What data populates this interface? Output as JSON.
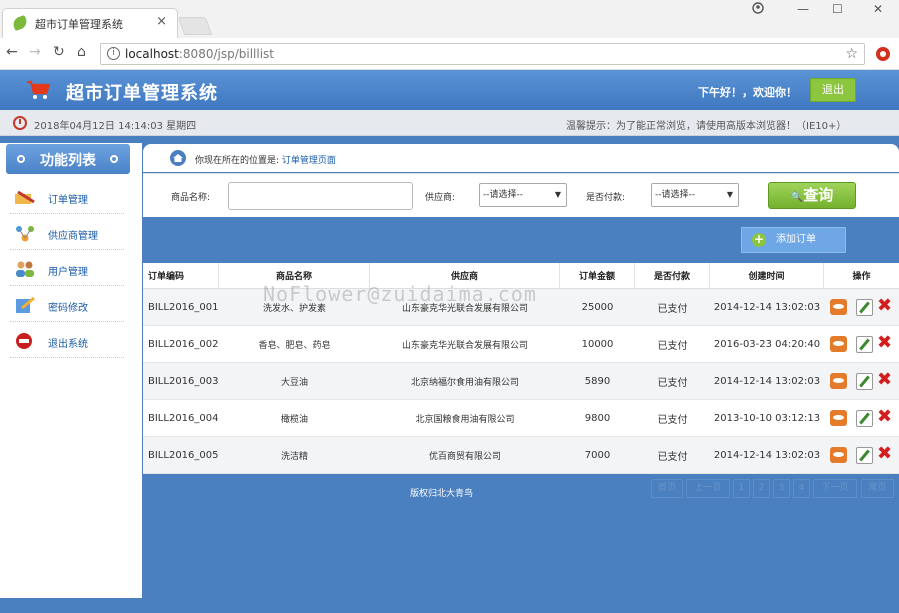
{
  "browser": {
    "tab_title": "超市订单管理系统",
    "tab_close": "×",
    "url_host": "localhost",
    "url_path": ":8080/jsp/billlist",
    "win_minimize": "—",
    "win_maximize": "☐",
    "win_close": "✕"
  },
  "header": {
    "title": "超市订单管理系统",
    "greeting": "下午好！，欢迎你！",
    "logout_label": "退出"
  },
  "info": {
    "datetime": "2018年04月12日 14:14:03 星期四",
    "tip": "温馨提示：为了能正常浏览，请使用高版本浏览器！（IE10+）"
  },
  "sidebar": {
    "title": "功能列表",
    "items": [
      {
        "label": "订单管理"
      },
      {
        "label": "供应商管理"
      },
      {
        "label": "用户管理"
      },
      {
        "label": "密码修改"
      },
      {
        "label": "退出系统"
      }
    ]
  },
  "breadcrumb": {
    "prefix": "你现在所在的位置是:",
    "current": "订单管理页面"
  },
  "search": {
    "product_label": "商品名称:",
    "product_value": "",
    "supplier_label": "供应商:",
    "supplier_selected": "--请选择--",
    "paid_label": "是否付款:",
    "paid_selected": "--请选择--",
    "query_label": "查询"
  },
  "toolbar": {
    "add_label": "添加订单"
  },
  "table": {
    "headers": [
      "订单编码",
      "商品名称",
      "供应商",
      "订单金额",
      "是否付款",
      "创建时间",
      "操作"
    ],
    "rows": [
      [
        "BILL2016_001",
        "洗发水、护发素",
        "山东豪克华光联合发展有限公司",
        "25000",
        "已支付",
        "2014-12-14 13:02:03"
      ],
      [
        "BILL2016_002",
        "香皂、肥皂、药皂",
        "山东豪克华光联合发展有限公司",
        "10000",
        "已支付",
        "2016-03-23 04:20:40"
      ],
      [
        "BILL2016_003",
        "大豆油",
        "北京纳福尔食用油有限公司",
        "5890",
        "已支付",
        "2014-12-14 13:02:03"
      ],
      [
        "BILL2016_004",
        "橄榄油",
        "北京国粮食用油有限公司",
        "9800",
        "已支付",
        "2013-10-10 03:12:13"
      ],
      [
        "BILL2016_005",
        "洗洁精",
        "优百商贸有限公司",
        "7000",
        "已支付",
        "2014-12-14 13:02:03"
      ]
    ]
  },
  "watermark": "NoFlower@zuidaima.com",
  "footer": {
    "copyright": "版权归北大青鸟"
  },
  "pager": {
    "first": "首页",
    "prev": "上一页",
    "pages": [
      "1",
      "2",
      "3",
      "4"
    ],
    "next": "下一页",
    "last": "尾页"
  },
  "colors": {
    "primary": "#4a7fc0",
    "accent_green": "#8cc63e",
    "delete_red": "#d41e1e"
  }
}
